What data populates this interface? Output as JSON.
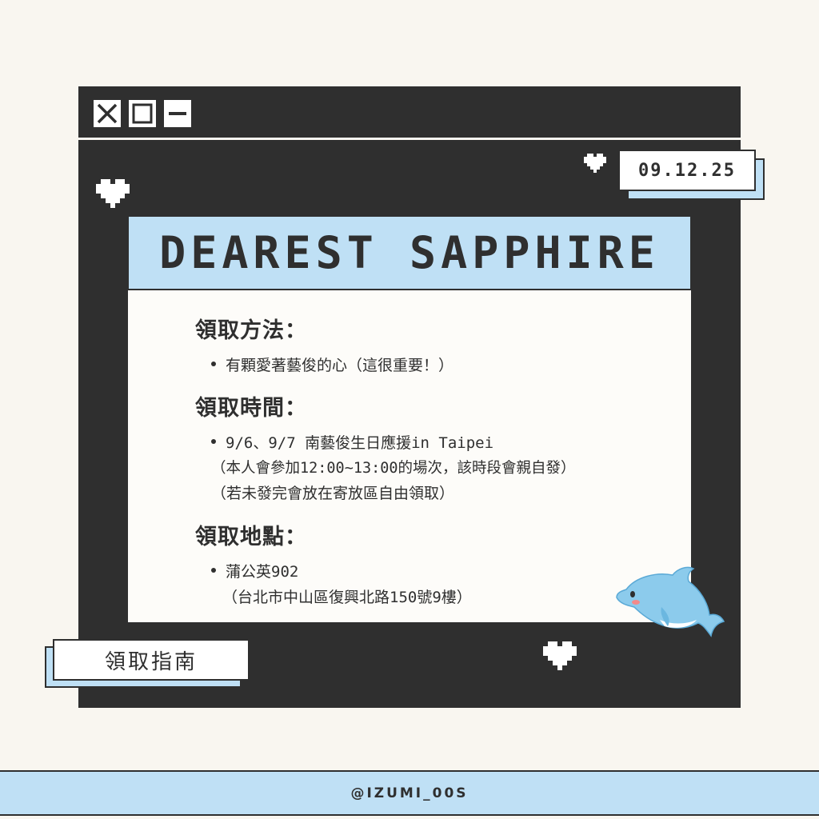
{
  "window": {
    "controls": [
      {
        "icon": "close-icon"
      },
      {
        "icon": "maximize-icon"
      },
      {
        "icon": "minimize-icon"
      }
    ]
  },
  "date": "09.12.25",
  "title": "DEAREST SAPPHIRE",
  "sections": [
    {
      "heading": "領取方法：",
      "items": [
        {
          "lines": [
            "有顆愛著藝俊的心（這很重要！）"
          ]
        }
      ]
    },
    {
      "heading": "領取時間：",
      "items": [
        {
          "lines": [
            "9/6、9/7 南藝俊生日應援in Taipei",
            "（本人會參加12:00~13:00的場次，該時段會親自發）",
            "（若未發完會放在寄放區自由領取）"
          ]
        }
      ]
    },
    {
      "heading": "領取地點：",
      "items": [
        {
          "lines": [
            "蒲公英902",
            "（台北市中山區復興北路150號9樓）"
          ]
        }
      ]
    }
  ],
  "guide_label": "領取指南",
  "footer_handle": "@IZUMI_00S",
  "colors": {
    "background": "#f9f6f0",
    "window": "#2f2f2f",
    "accent_blue": "#bfe0f5",
    "panel": "#fdfcf9"
  }
}
